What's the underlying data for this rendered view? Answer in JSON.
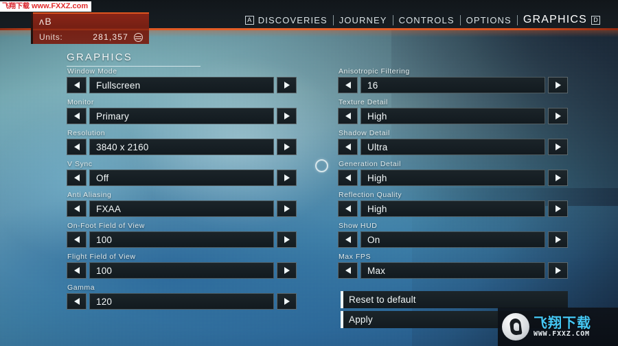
{
  "header": {
    "nav": [
      {
        "label": "DISCOVERIES",
        "key": "A",
        "active": false
      },
      {
        "label": "JOURNEY",
        "key": "",
        "active": false
      },
      {
        "label": "CONTROLS",
        "key": "",
        "active": false
      },
      {
        "label": "OPTIONS",
        "key": "",
        "active": false
      },
      {
        "label": "GRAPHICS",
        "key": "D",
        "active": true
      }
    ],
    "nav_key_discoveries": "A",
    "nav_key_graphics": "D"
  },
  "player": {
    "name": "ʌB",
    "units_label": "Units:",
    "units_value": "281,357",
    "currency_icon": "units-circle-icon"
  },
  "page": {
    "title": "GRAPHICS"
  },
  "settings_left": [
    {
      "label": "Window Mode",
      "value": "Fullscreen"
    },
    {
      "label": "Monitor",
      "value": "Primary"
    },
    {
      "label": "Resolution",
      "value": "3840 x 2160"
    },
    {
      "label": "V Sync",
      "value": "Off"
    },
    {
      "label": "Anti Aliasing",
      "value": "FXAA"
    },
    {
      "label": "On-Foot Field of View",
      "value": "100"
    },
    {
      "label": "Flight Field of View",
      "value": "100"
    },
    {
      "label": "Gamma",
      "value": "120"
    }
  ],
  "settings_right": [
    {
      "label": "Anisotropic Filtering",
      "value": "16"
    },
    {
      "label": "Texture Detail",
      "value": "High"
    },
    {
      "label": "Shadow Detail",
      "value": "Ultra"
    },
    {
      "label": "Generation Detail",
      "value": "High"
    },
    {
      "label": "Reflection Quality",
      "value": "High"
    },
    {
      "label": "Show HUD",
      "value": "On"
    },
    {
      "label": "Max FPS",
      "value": "Max"
    }
  ],
  "actions": [
    {
      "label": "Reset to default"
    },
    {
      "label": "Apply"
    }
  ],
  "cursor": {
    "name": "reticle-cursor"
  },
  "watermark_top": {
    "cn": "飞翔下载",
    "url": "www.FXXZ.com"
  },
  "watermark_bottom": {
    "cn": "飞翔下载",
    "url": "WWW.FXXZ.COM"
  },
  "colors": {
    "accent_orange": "#e0551f",
    "panel_red": "#962616",
    "field_dark": "#1b2429",
    "text_light": "#f4f9fa",
    "watermark_blue": "#45c8f5",
    "watermark_red": "#e02c2c"
  }
}
